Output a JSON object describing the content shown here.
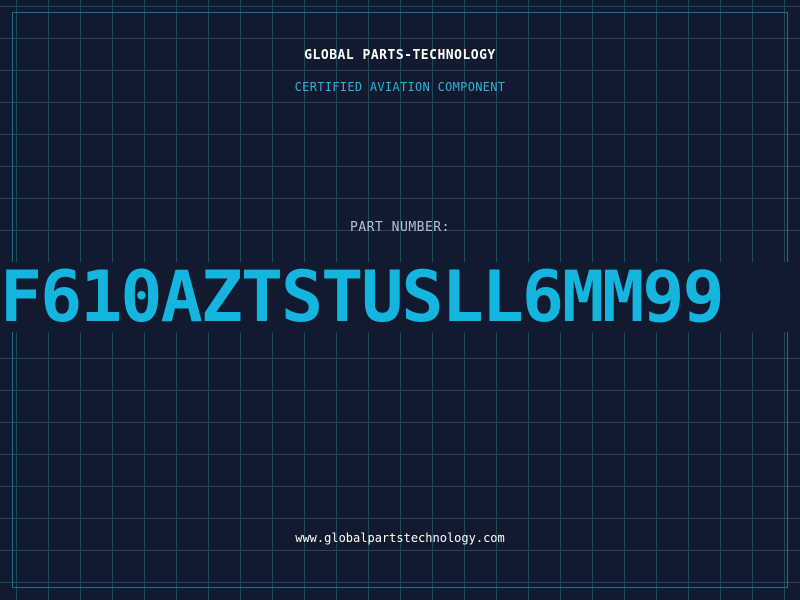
{
  "brand": {
    "name": "GLOBAL PARTS-TECHNOLOGY",
    "subtitle": "CERTIFIED AVIATION COMPONENT"
  },
  "part": {
    "label": "PART NUMBER:",
    "number": "F610AZTSTUSLL6MM99"
  },
  "footer": {
    "url": "www.globalpartstechnology.com"
  },
  "colors": {
    "background": "#111a2e",
    "grid": "#1d4a5e",
    "accent": "#14b5de",
    "text": "#ffffff"
  }
}
